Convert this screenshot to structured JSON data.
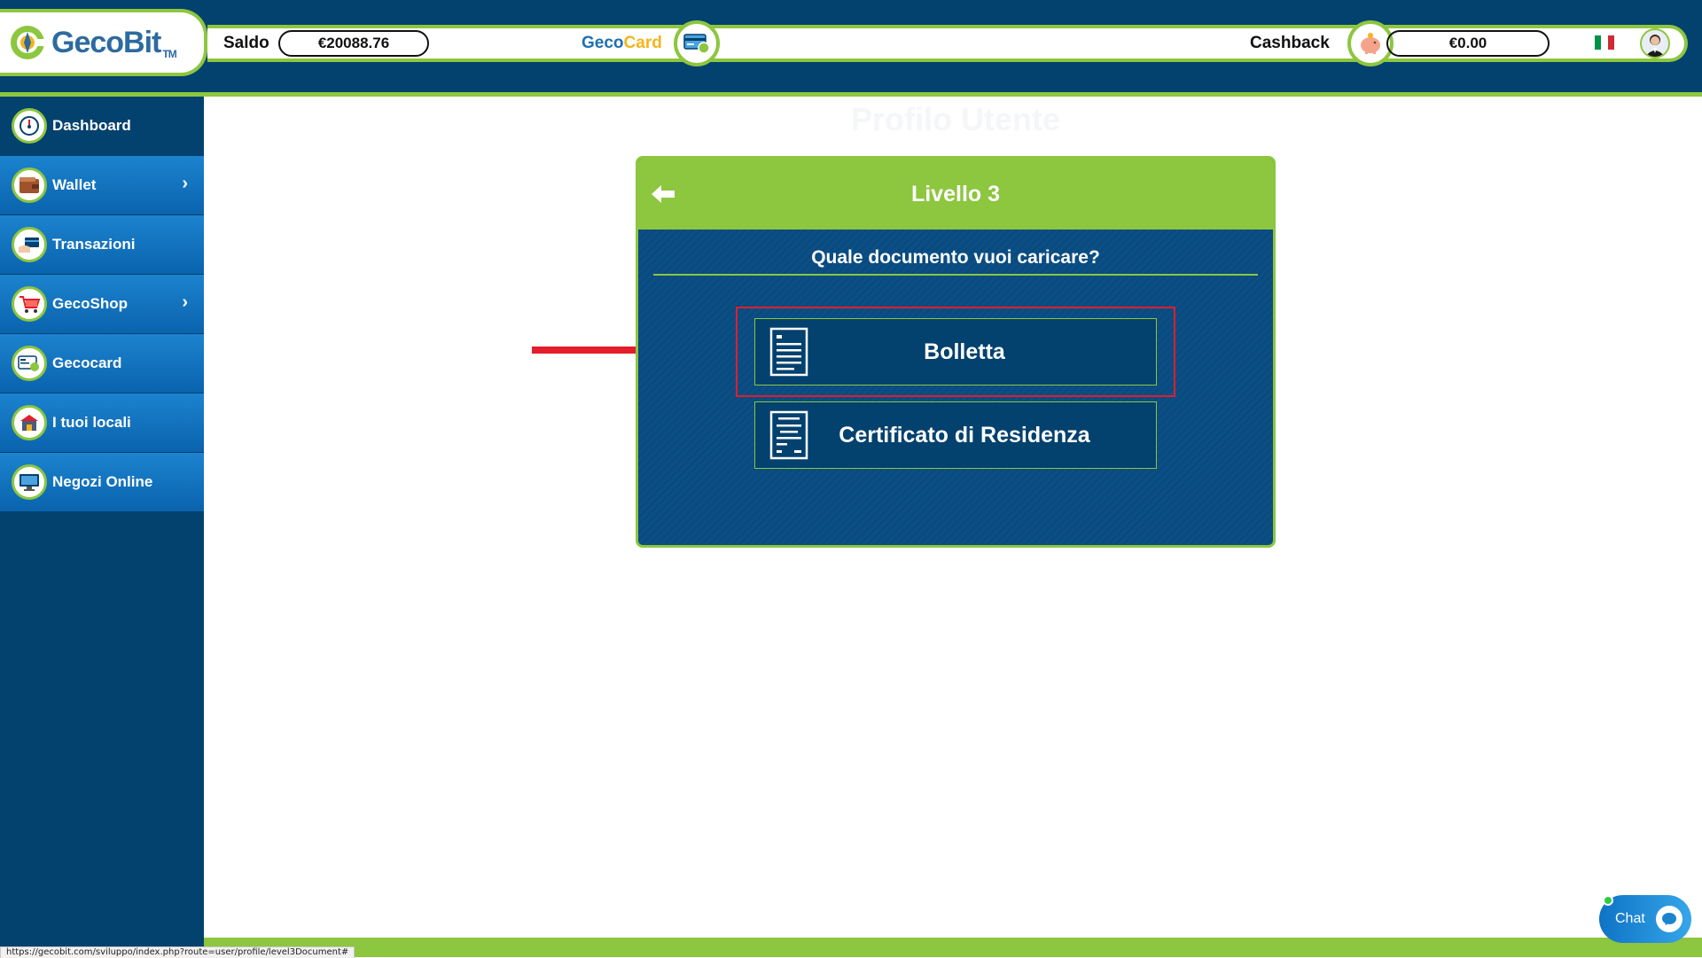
{
  "header": {
    "logo_text": "GecoBit",
    "logo_tm": "TM",
    "saldo_label": "Saldo",
    "saldo_value": "€20088.76",
    "gecocard_prefix": "Geco",
    "gecocard_suffix": "Card",
    "cashback_label": "Cashback",
    "cashback_value": "€0.00",
    "language_icon": "italy-flag-icon",
    "avatar_icon": "user-avatar-icon"
  },
  "sidebar": {
    "items": [
      {
        "label": "Dashboard",
        "icon": "dashboard-gauge-icon",
        "has_submenu": false
      },
      {
        "label": "Wallet",
        "icon": "wallet-icon",
        "has_submenu": true
      },
      {
        "label": "Transazioni",
        "icon": "card-hand-icon",
        "has_submenu": false
      },
      {
        "label": "GecoShop",
        "icon": "shopping-cart-icon",
        "has_submenu": true
      },
      {
        "label": "Gecocard",
        "icon": "gecocard-icon",
        "has_submenu": false
      },
      {
        "label": "I tuoi locali",
        "icon": "store-icon",
        "has_submenu": false
      },
      {
        "label": "Negozi Online",
        "icon": "monitor-icon",
        "has_submenu": false
      }
    ]
  },
  "main": {
    "page_title": "Profilo Utente",
    "card": {
      "title": "Livello 3",
      "question": "Quale documento vuoi caricare?",
      "options": [
        {
          "label": "Bolletta",
          "icon": "document-icon"
        },
        {
          "label": "Certificato di Residenza",
          "icon": "document-icon"
        }
      ]
    }
  },
  "chat": {
    "label": "Chat"
  },
  "status_bar": {
    "url": "https://gecobit.com/sviluppo/index.php?route=user/profile/level3Document#"
  },
  "colors": {
    "navy": "#03416e",
    "green": "#8dc63f",
    "blue": "#1c83cf",
    "highlight_red": "#e31d2b"
  }
}
